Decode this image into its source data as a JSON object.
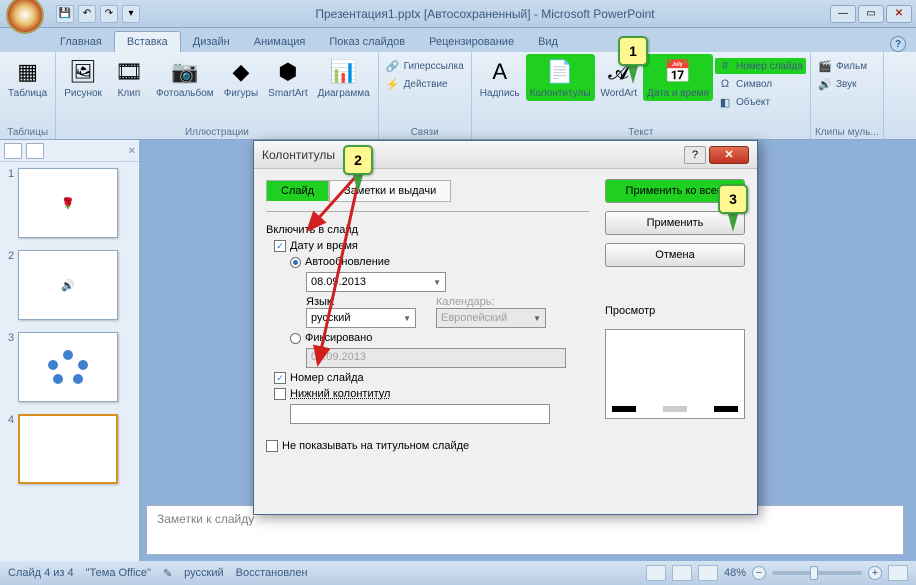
{
  "title": "Презентация1.pptx [Автосохраненный] - Microsoft PowerPoint",
  "tabs": {
    "home": "Главная",
    "insert": "Вставка",
    "design": "Дизайн",
    "animation": "Анимация",
    "slideshow": "Показ слайдов",
    "review": "Рецензирование",
    "view": "Вид"
  },
  "ribbon": {
    "groups": {
      "tables": "Таблицы",
      "illustrations": "Иллюстрации",
      "links": "Связи",
      "text": "Текст",
      "media": "Клипы муль..."
    },
    "buttons": {
      "table": "Таблица",
      "picture": "Рисунок",
      "clip": "Клип",
      "album": "Фотоальбом",
      "shapes": "Фигуры",
      "smartart": "SmartArt",
      "chart": "Диаграмма",
      "hyperlink": "Гиперссылка",
      "action": "Действие",
      "textbox": "Надпись",
      "headerfooter": "Колонтитулы",
      "wordart": "WordArt",
      "datetime": "Дата и время",
      "slidenum": "Номер слайда",
      "symbol": "Символ",
      "object": "Объект",
      "movie": "Фильм",
      "sound": "Звук"
    }
  },
  "callouts": {
    "c1": "1",
    "c2": "2",
    "c3": "3"
  },
  "dialog": {
    "title": "Колонтитулы",
    "tabs": {
      "slide": "Слайд",
      "notes": "Заметки и выдачи"
    },
    "include_label": "Включить в слайд",
    "datetime_chk": "Дату и время",
    "auto_radio": "Автообновление",
    "date_value": "08.09.2013",
    "lang_label": "Язык:",
    "lang_value": "русский",
    "cal_label": "Календарь:",
    "cal_value": "Европейский",
    "fixed_radio": "Фиксировано",
    "fixed_value": "08.09.2013",
    "slidenum_chk": "Номер слайда",
    "footer_chk": "Нижний колонтитул",
    "noshow_chk": "Не показывать на титульном слайде",
    "apply_all": "Применить ко всем",
    "apply": "Применить",
    "cancel": "Отмена",
    "preview_label": "Просмотр"
  },
  "notes_placeholder": "Заметки к слайду",
  "status": {
    "slide": "Слайд 4 из 4",
    "theme": "\"Тема Office\"",
    "lang": "русский",
    "state": "Восстановлен",
    "zoom": "48%"
  },
  "thumbs": [
    "1",
    "2",
    "3",
    "4"
  ]
}
